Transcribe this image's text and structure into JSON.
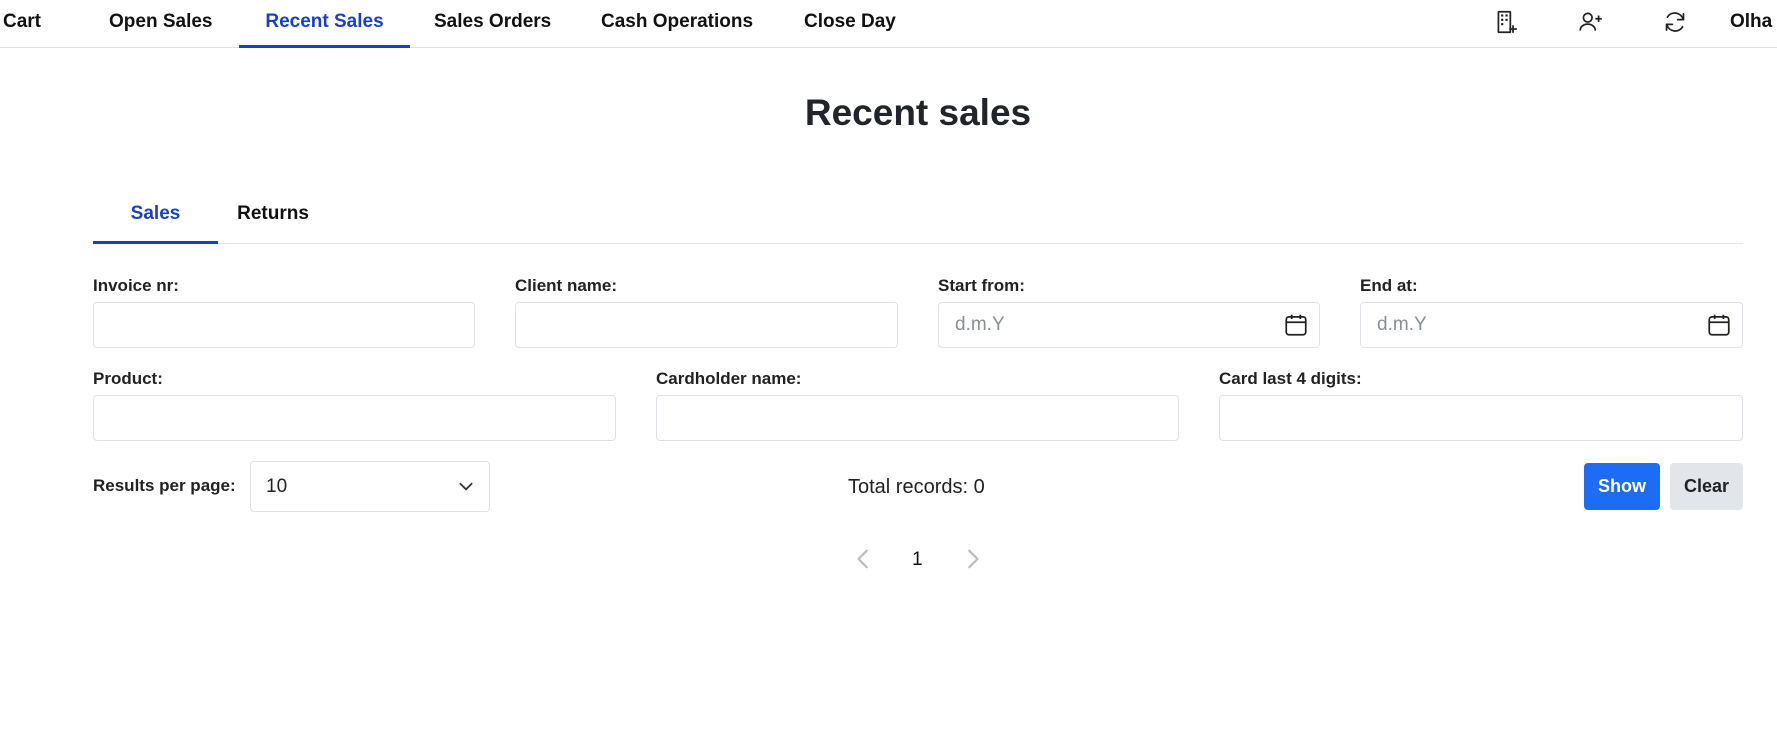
{
  "nav": {
    "tabs": [
      {
        "label": "Cart"
      },
      {
        "label": "Open Sales"
      },
      {
        "label": "Recent Sales"
      },
      {
        "label": "Sales Orders"
      },
      {
        "label": "Cash Operations"
      },
      {
        "label": "Close Day"
      }
    ],
    "active_tab": "Recent Sales",
    "icons": [
      "building-add-icon",
      "user-add-icon",
      "refresh-icon"
    ],
    "user_name": "Olha"
  },
  "page": {
    "title": "Recent sales"
  },
  "subtabs": [
    {
      "label": "Sales"
    },
    {
      "label": "Returns"
    }
  ],
  "active_subtab": "Sales",
  "filters": {
    "invoice_nr": {
      "label": "Invoice nr:",
      "value": ""
    },
    "client_name": {
      "label": "Client name:",
      "value": ""
    },
    "start_from": {
      "label": "Start from:",
      "value": "",
      "placeholder": "d.m.Y"
    },
    "end_at": {
      "label": "End at:",
      "value": "",
      "placeholder": "d.m.Y"
    },
    "product": {
      "label": "Product:",
      "value": ""
    },
    "cardholder_name": {
      "label": "Cardholder name:",
      "value": ""
    },
    "card_last4": {
      "label": "Card last 4 digits:",
      "value": ""
    }
  },
  "results": {
    "per_page_label": "Results per page:",
    "per_page_value": "10",
    "total_records": "Total records: 0",
    "show_label": "Show",
    "clear_label": "Clear"
  },
  "pagination": {
    "current_page": "1"
  },
  "colors": {
    "accent": "#1b3fc4",
    "primary_button": "#1d6cf5",
    "secondary_button": "#e2e6ea",
    "border": "#dee2e6"
  }
}
